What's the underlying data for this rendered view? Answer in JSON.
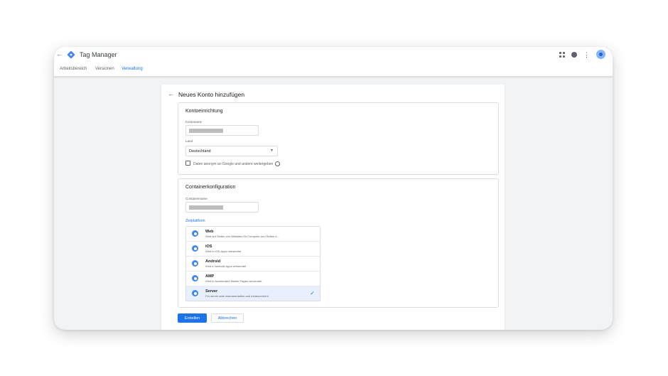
{
  "header": {
    "title": "Tag Manager",
    "icons": [
      "back-arrow-icon",
      "tag-manager-logo-icon",
      "apps-grid-icon",
      "help-icon",
      "more-vert-icon",
      "account-avatar-icon"
    ]
  },
  "tabs": [
    {
      "label": "Arbeitsbereich",
      "active": false
    },
    {
      "label": "Versionen",
      "active": false
    },
    {
      "label": "Verwaltung",
      "active": true
    }
  ],
  "panel": {
    "back_icon": "arrow-back-icon",
    "title": "Neues Konto hinzufügen"
  },
  "account_setup": {
    "title": "Kontoeinrichtung",
    "account_name_label": "Kontoname",
    "country_label": "Land",
    "country_value": "Deutschland",
    "share_data_label": "Daten anonym an Google und andere weitergeben",
    "share_data_checked": false
  },
  "container_setup": {
    "title": "Containerkonfiguration",
    "container_name_label": "Containername",
    "target_platform_label": "Zielplattform",
    "platforms": [
      {
        "name": "Web",
        "desc": "Wird auf Seiten von Websites für Computer und Seiten d...",
        "icon": "web-icon",
        "selected": false
      },
      {
        "name": "iOS",
        "desc": "Wird in iOS-Apps verwendet",
        "icon": "ios-icon",
        "selected": false
      },
      {
        "name": "Android",
        "desc": "Wird in Android-Apps verwendet",
        "icon": "android-icon",
        "selected": false
      },
      {
        "name": "AMP",
        "desc": "Wird in Accelerated Mobile Pages verwendet",
        "icon": "amp-icon",
        "selected": false
      },
      {
        "name": "Server",
        "desc": "For server-side instrumentation and measurement",
        "icon": "server-icon",
        "selected": true
      }
    ]
  },
  "actions": {
    "create_label": "Erstellen",
    "cancel_label": "Abbrechen"
  },
  "colors": {
    "accent": "#1a73e8",
    "selected_row": "#e8f0fe",
    "background": "#f1f3f4"
  }
}
